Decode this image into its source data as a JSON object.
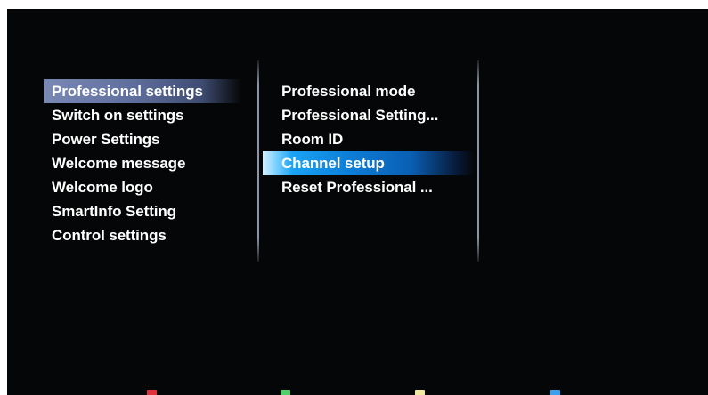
{
  "menu": {
    "left_items": [
      {
        "label": "Professional settings",
        "selected": true
      },
      {
        "label": "Switch on settings"
      },
      {
        "label": "Power Settings"
      },
      {
        "label": "Welcome message"
      },
      {
        "label": "Welcome logo"
      },
      {
        "label": "SmartInfo Setting"
      },
      {
        "label": "Control settings"
      }
    ],
    "right_items": [
      {
        "label": "Professional mode"
      },
      {
        "label": "Professional Setting..."
      },
      {
        "label": "Room ID"
      },
      {
        "label": "Channel setup",
        "selected": true
      },
      {
        "label": "Reset Professional ..."
      }
    ]
  },
  "color_keys": {
    "red": "#e0303a",
    "green": "#4fd06a",
    "yellow": "#f2e8a0",
    "blue": "#3aa0f0"
  },
  "colors": {
    "background": "#050607",
    "text": "#ffffff",
    "selection_left": "#6a79a8",
    "selection_mid": "#0c7fd8"
  }
}
